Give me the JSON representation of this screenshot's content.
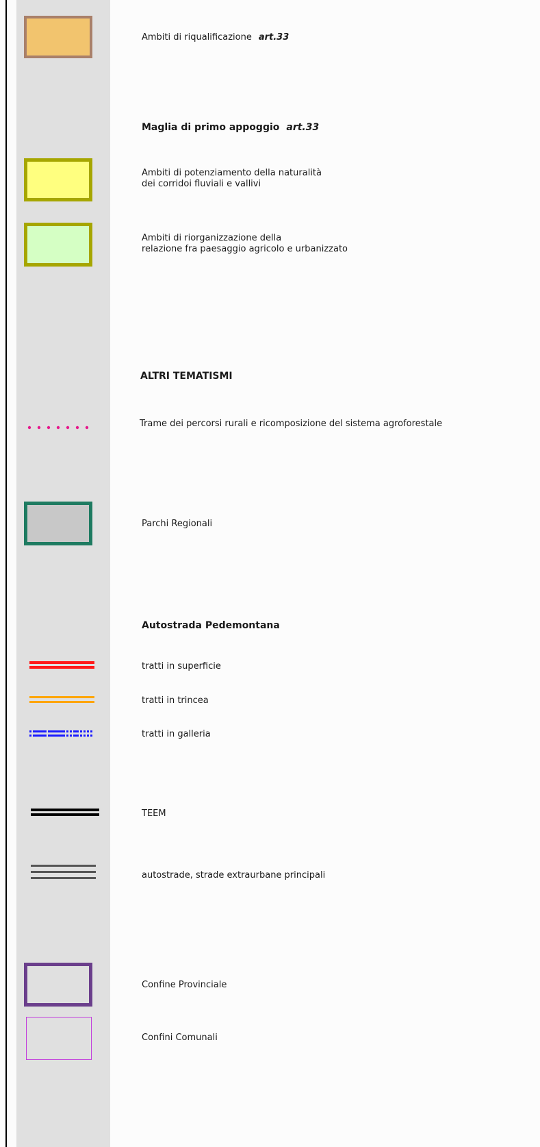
{
  "legend": {
    "riqualificazione": {
      "label": "Ambiti di riqualificazione",
      "art": "art.33"
    },
    "maglia_header": {
      "label": "Maglia di primo appoggio",
      "art": "art.33"
    },
    "potenziamento": {
      "line1": "Ambiti di potenziamento della naturalità",
      "line2": "dei corridoi fluviali e vallivi"
    },
    "riorganizzazione": {
      "line1": "Ambiti di riorganizzazione della",
      "line2": "relazione fra paesaggio agricolo e urbanizzato"
    },
    "altri_header": "ALTRI TEMATISMI",
    "trame": "Trame dei percorsi rurali e ricomposizione del sistema agroforestale",
    "parchi": "Parchi Regionali",
    "autostrada_header": "Autostrada Pedemontana",
    "superficie": "tratti in superficie",
    "trincea": "tratti in trincea",
    "galleria": "tratti in galleria",
    "teem": "TEEM",
    "autostrade": "autostrade, strade extraurbane principali",
    "confine_provinciale": "Confine Provinciale",
    "confini_comunali": "Confini Comunali"
  },
  "colors": {
    "riqualificazione_fill": "#f2c46e",
    "riqualificazione_border": "#a9806a",
    "potenziamento_fill": "#ffff7f",
    "riorganizzazione_fill": "#d5ffc4",
    "olive_border": "#a6a600",
    "trame_dots": "#e6198c",
    "parchi_fill": "#c8c8c8",
    "parchi_border": "#1e7b61",
    "superficie": "#ff1a1a",
    "trincea": "#ffa500",
    "galleria": "#1a1aff",
    "teem": "#000000",
    "autostrade": "#555555",
    "provinciale": "#6b3f8c",
    "comunali": "#c23cdc"
  }
}
